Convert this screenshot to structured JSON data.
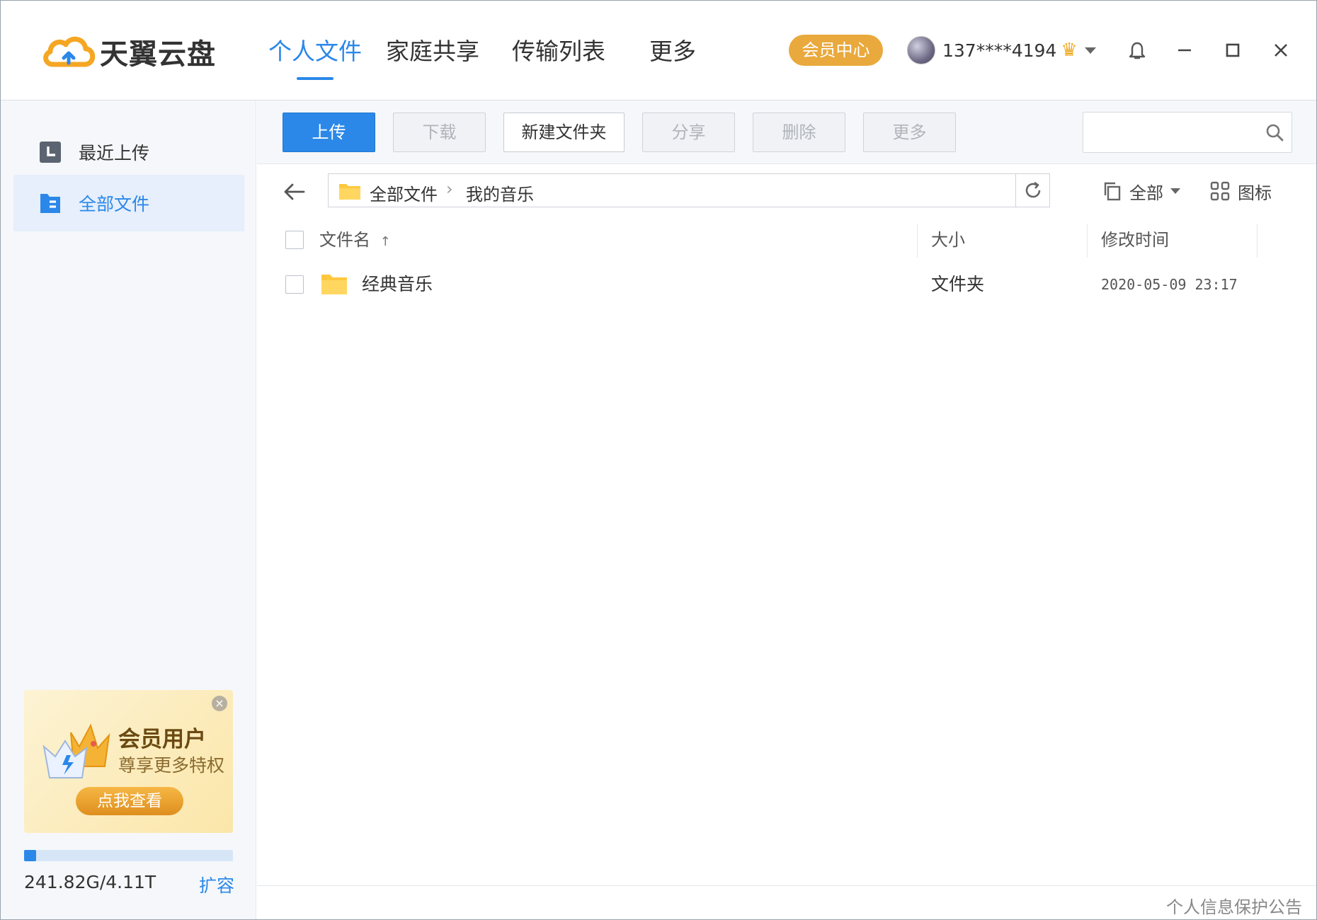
{
  "app": {
    "name": "天翼云盘"
  },
  "nav": {
    "tabs": [
      {
        "label": "个人文件",
        "active": true
      },
      {
        "label": "家庭共享"
      },
      {
        "label": "传输列表"
      },
      {
        "label": "更多"
      }
    ]
  },
  "header": {
    "vip_button": "会员中心",
    "username": "137****4194"
  },
  "sidebar": {
    "items": [
      {
        "label": "最近上传",
        "icon": "clock-icon"
      },
      {
        "label": "全部文件",
        "icon": "file-list-icon",
        "active": true
      }
    ],
    "promo": {
      "title": "会员用户",
      "subtitle": "尊享更多特权",
      "button": "点我查看"
    },
    "storage": {
      "used_text": "241.82G/4.11T",
      "used_fraction": 0.057,
      "expand_label": "扩容"
    }
  },
  "toolbar": {
    "upload": "上传",
    "download": "下载",
    "new_folder": "新建文件夹",
    "share": "分享",
    "delete": "删除",
    "more": "更多",
    "search_placeholder": ""
  },
  "path": {
    "crumbs": [
      "全部文件",
      "我的音乐"
    ],
    "separator": "›"
  },
  "filters": {
    "type_filter": "全部",
    "view_mode": "图标"
  },
  "table": {
    "columns": {
      "name": "文件名",
      "sort_indicator": "↑",
      "size": "大小",
      "modified": "修改时间"
    },
    "rows": [
      {
        "name": "经典音乐",
        "size": "文件夹",
        "modified": "2020-05-09 23:17"
      }
    ]
  },
  "footer": {
    "privacy_link": "个人信息保护公告"
  },
  "colors": {
    "accent": "#2b88e9",
    "vip_gold": "#e9a93c",
    "folder_yellow": "#ffd04a"
  }
}
